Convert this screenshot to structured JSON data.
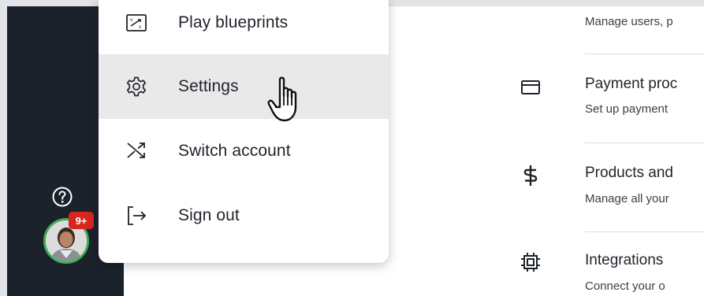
{
  "menu": {
    "items": [
      {
        "label": "Play blueprints",
        "icon": "blueprint-icon"
      },
      {
        "label": "Settings",
        "icon": "gear-icon"
      },
      {
        "label": "Switch account",
        "icon": "shuffle-icon"
      },
      {
        "label": "Sign out",
        "icon": "sign-out-icon"
      }
    ]
  },
  "sidebar": {
    "notification_badge": "9+",
    "help_icon": "help-circle-icon"
  },
  "settings": {
    "rows": [
      {
        "title": "",
        "desc": "Manage users, p",
        "icon": ""
      },
      {
        "title": "Payment proc",
        "desc": "Set up payment",
        "icon": "card-icon"
      },
      {
        "title": "Products and",
        "desc": "Manage all your",
        "icon": "dollar-icon"
      },
      {
        "title": "Integrations",
        "desc": "Connect your o",
        "icon": "chip-icon"
      }
    ]
  },
  "colors": {
    "sidebar_bg": "#1b222c",
    "hover_bg": "#e9e9ea",
    "badge_red": "#d7261e",
    "avatar_ring": "#3fae56"
  }
}
